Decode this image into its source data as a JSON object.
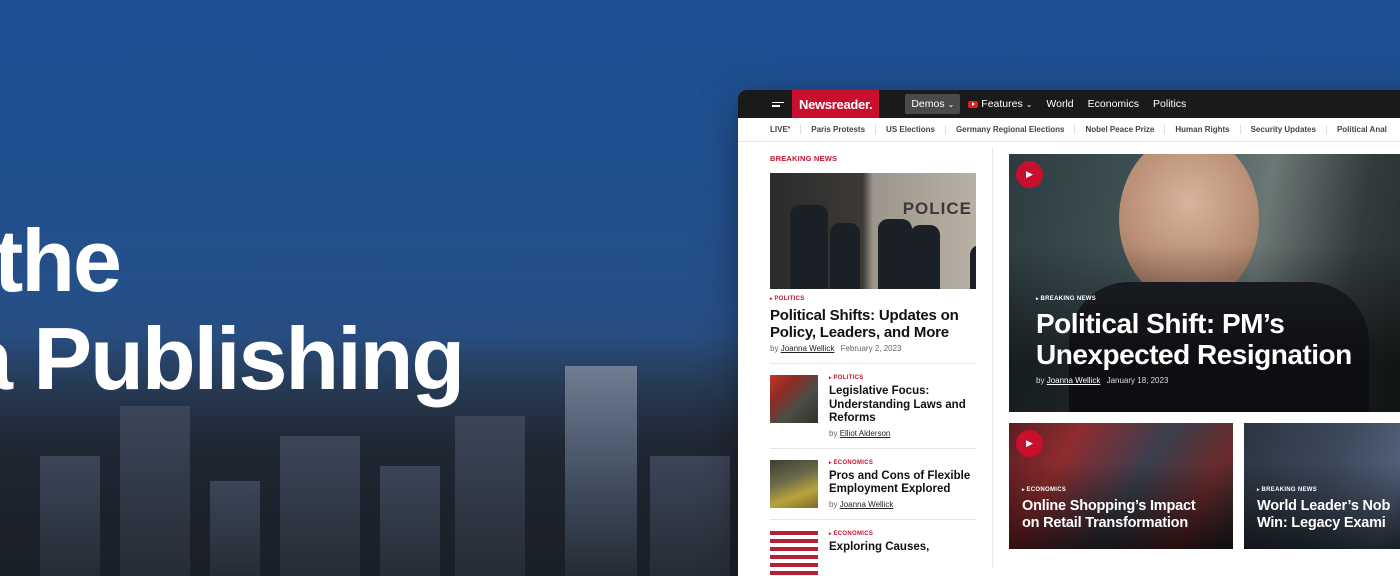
{
  "hero": {
    "title_line1": "the",
    "title_line2": "a Publishing"
  },
  "app": {
    "logo": "Newsreader.",
    "nav": [
      {
        "label": "Demos",
        "icon": "chevron-down-icon",
        "active": true
      },
      {
        "label": "Features",
        "icon": "youtube-icon"
      },
      {
        "label": "World"
      },
      {
        "label": "Economics"
      },
      {
        "label": "Politics"
      }
    ],
    "subnav": {
      "live": "LIVE",
      "live_marker": "•",
      "items": [
        "Paris Protests",
        "US Elections",
        "Germany Regional Elections",
        "Nobel Peace Prize",
        "Human Rights",
        "Security Updates",
        "Political Anal"
      ]
    }
  },
  "left": {
    "section_label": "BREAKING NEWS",
    "lead": {
      "image_sign": "POLICE",
      "category": "POLITICS",
      "headline": "Political Shifts: Updates on Policy, Leaders, and More",
      "by": "by",
      "author": "Joanna Wellick",
      "date": "February 2, 2023"
    },
    "stories": [
      {
        "category": "POLITICS",
        "headline": "Legislative Focus: Understanding Laws and Reforms",
        "by": "by",
        "author": "Elliot Alderson"
      },
      {
        "category": "ECONOMICS",
        "headline": "Pros and Cons of Flexible Employment Explored",
        "by": "by",
        "author": "Joanna Wellick"
      },
      {
        "category": "ECONOMICS",
        "headline": "Exploring Causes,"
      }
    ]
  },
  "feature": {
    "category": "BREAKING NEWS",
    "headline": "Political Shift: PM’s Unexpected Resignation",
    "by": "by",
    "author": "Joanna Wellick",
    "date": "January 18, 2023"
  },
  "tiles": [
    {
      "category": "ECONOMICS",
      "headline_l1": "Online Shopping’s Impact",
      "headline_l2": "on Retail Transformation"
    },
    {
      "category": "BREAKING NEWS",
      "headline_l1": "World Leader’s Nob",
      "headline_l2": "Win: Legacy Exami"
    }
  ],
  "colors": {
    "brand_red": "#c8102e",
    "topbar": "#1a1a1a",
    "hero_blue": "#1e4f93"
  }
}
